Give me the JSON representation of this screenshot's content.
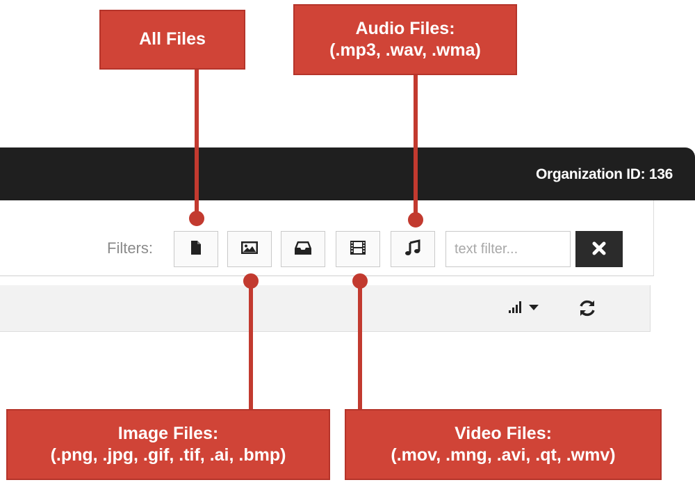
{
  "header": {
    "org_id": "Organization ID: 136"
  },
  "toolbar": {
    "filters_label": "Filters:",
    "filter_buttons": [
      {
        "name": "all-files",
        "icon": "file-icon"
      },
      {
        "name": "image-files",
        "icon": "picture-icon"
      },
      {
        "name": "archive-files",
        "icon": "inbox-icon"
      },
      {
        "name": "video-files",
        "icon": "film-icon"
      },
      {
        "name": "audio-files",
        "icon": "music-note-icon"
      }
    ],
    "text_filter_placeholder": "text filter...",
    "text_filter_value": "",
    "clear_icon": "close-icon"
  },
  "subbar": {
    "sort_icon": "signal-bars-icon",
    "refresh_icon": "refresh-icon"
  },
  "callouts": {
    "all_files": {
      "line1": "All Files"
    },
    "audio_files": {
      "line1": "Audio Files:",
      "line2": "(.mp3, .wav, .wma)"
    },
    "image_files": {
      "line1": "Image Files:",
      "line2": "(.png, .jpg, .gif, .tif, .ai, .bmp)"
    },
    "video_files": {
      "line1": "Video Files:",
      "line2": "(.mov, .mng, .avi, .qt, .wmv)"
    }
  },
  "colors": {
    "callout_red": "#d04437",
    "topbar": "#1f1f1f",
    "clear_button": "#2b2b2b"
  }
}
